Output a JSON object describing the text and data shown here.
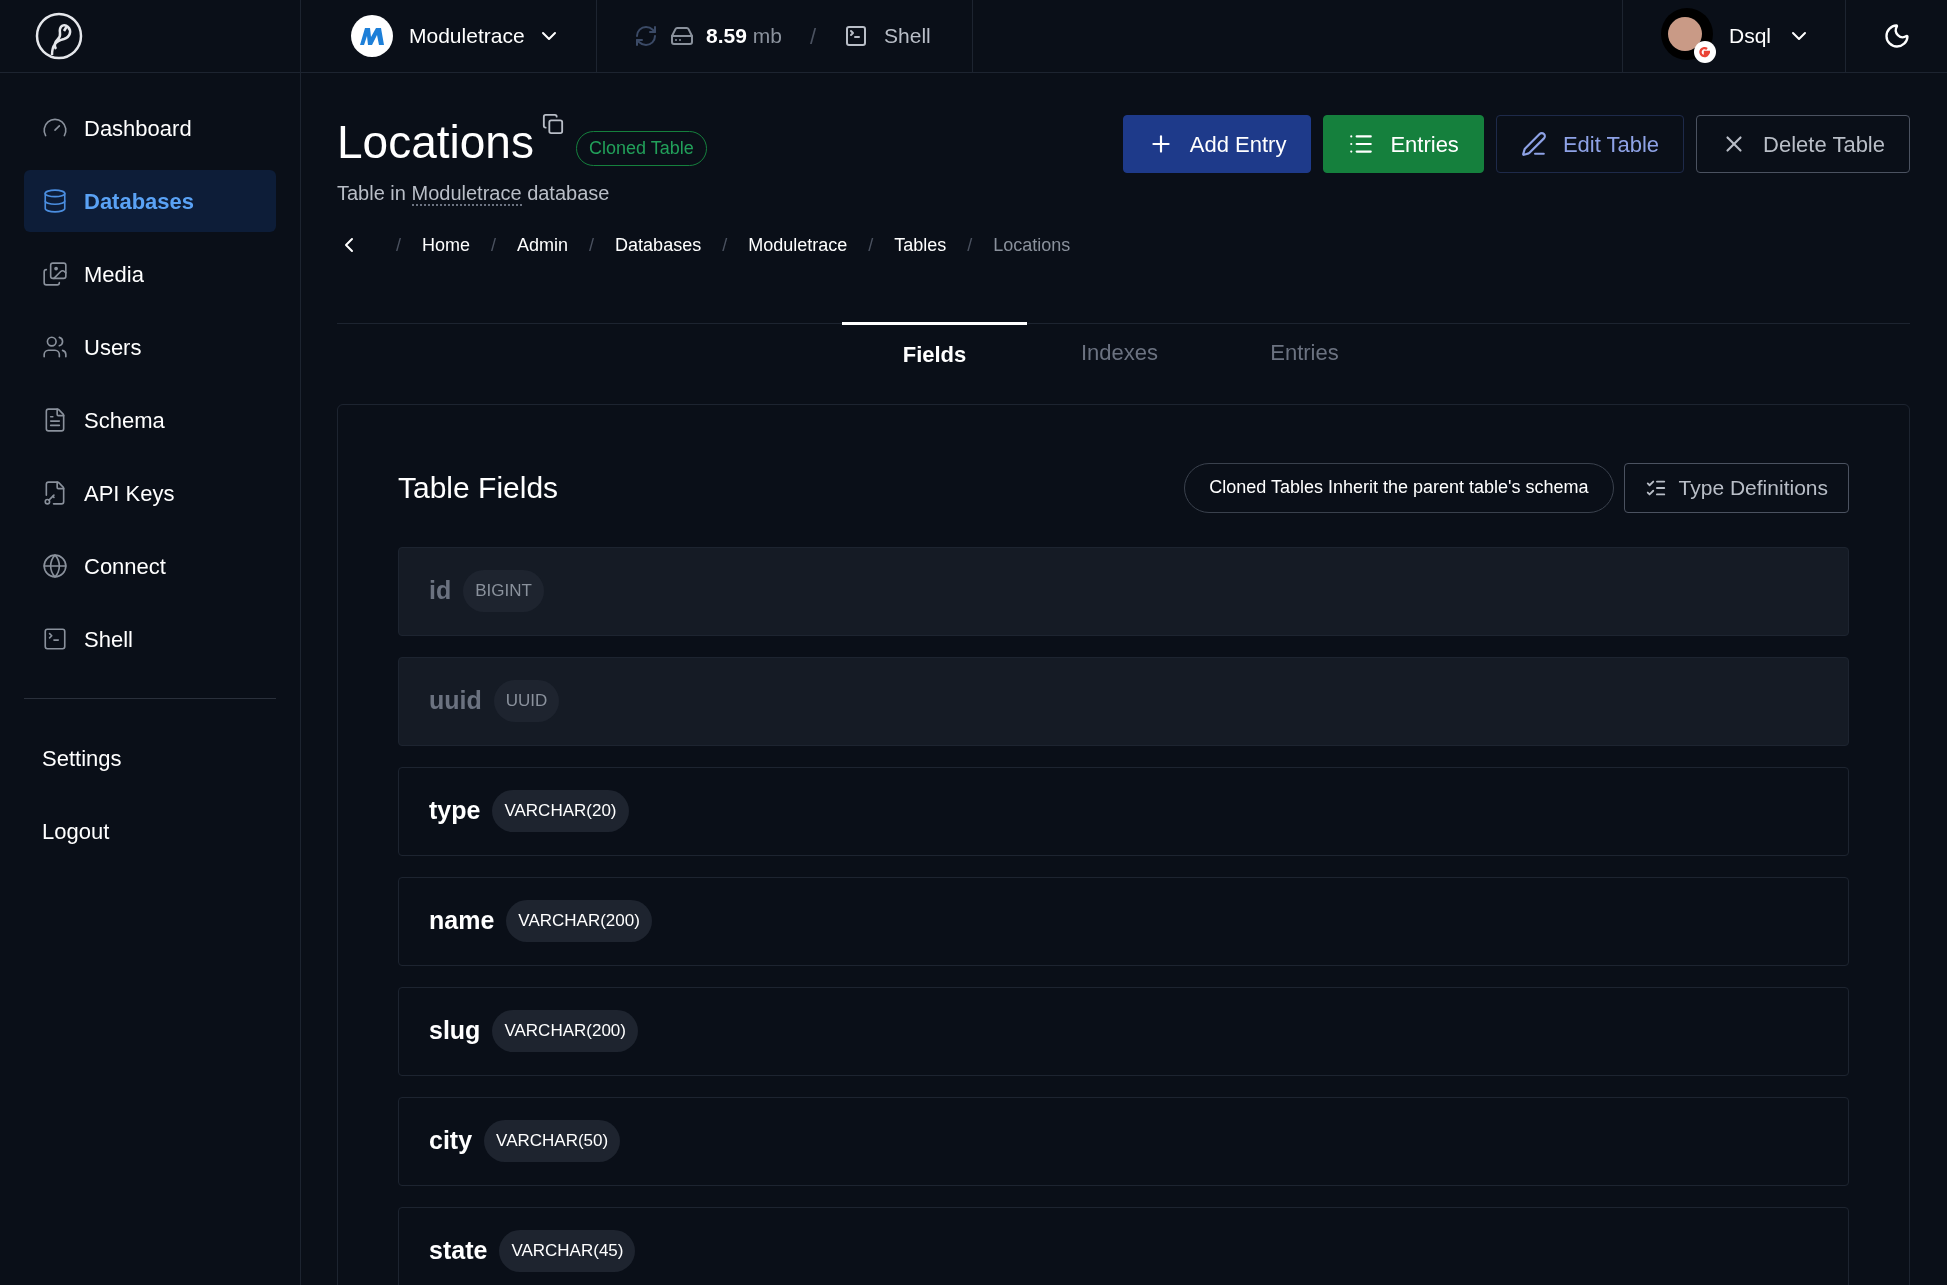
{
  "topbar": {
    "project": "Moduletrace",
    "size_value": "8.59",
    "size_unit": "mb",
    "separator": "/",
    "shell": "Shell",
    "user": "Dsql"
  },
  "sidebar": {
    "items": [
      {
        "label": "Dashboard",
        "selected": false
      },
      {
        "label": "Databases",
        "selected": true
      },
      {
        "label": "Media",
        "selected": false
      },
      {
        "label": "Users",
        "selected": false
      },
      {
        "label": "Schema",
        "selected": false
      },
      {
        "label": "API Keys",
        "selected": false
      },
      {
        "label": "Connect",
        "selected": false
      },
      {
        "label": "Shell",
        "selected": false
      }
    ],
    "footer_items": [
      "Settings",
      "Logout"
    ]
  },
  "header": {
    "title": "Locations",
    "badge": "Cloned Table",
    "subtitle_prefix": "Table in",
    "subtitle_link": "Moduletrace",
    "subtitle_suffix": "database",
    "actions": [
      {
        "label": "Add Entry",
        "kind": "primary"
      },
      {
        "label": "Entries",
        "kind": "success"
      },
      {
        "label": "Edit Table",
        "kind": "edit"
      },
      {
        "label": "Delete Table",
        "kind": "outline"
      }
    ]
  },
  "breadcrumbs": [
    {
      "label": "Home",
      "current": false
    },
    {
      "label": "Admin",
      "current": false
    },
    {
      "label": "Databases",
      "current": false
    },
    {
      "label": "Moduletrace",
      "current": false
    },
    {
      "label": "Tables",
      "current": false
    },
    {
      "label": "Locations",
      "current": true
    }
  ],
  "breadcrumb_separator": "/",
  "tabs": [
    {
      "label": "Fields",
      "selected": true
    },
    {
      "label": "Indexes",
      "selected": false
    },
    {
      "label": "Entries",
      "selected": false
    }
  ],
  "card": {
    "title": "Table Fields",
    "note": "Cloned Tables Inherit the parent table's schema",
    "type_definitions": "Type Definitions",
    "fields": [
      {
        "name": "id",
        "type": "BIGINT",
        "disabled": true
      },
      {
        "name": "uuid",
        "type": "UUID",
        "disabled": true
      },
      {
        "name": "type",
        "type": "VARCHAR(20)",
        "disabled": false
      },
      {
        "name": "name",
        "type": "VARCHAR(200)",
        "disabled": false
      },
      {
        "name": "slug",
        "type": "VARCHAR(200)",
        "disabled": false
      },
      {
        "name": "city",
        "type": "VARCHAR(50)",
        "disabled": false
      },
      {
        "name": "state",
        "type": "VARCHAR(45)",
        "disabled": false
      }
    ]
  }
}
